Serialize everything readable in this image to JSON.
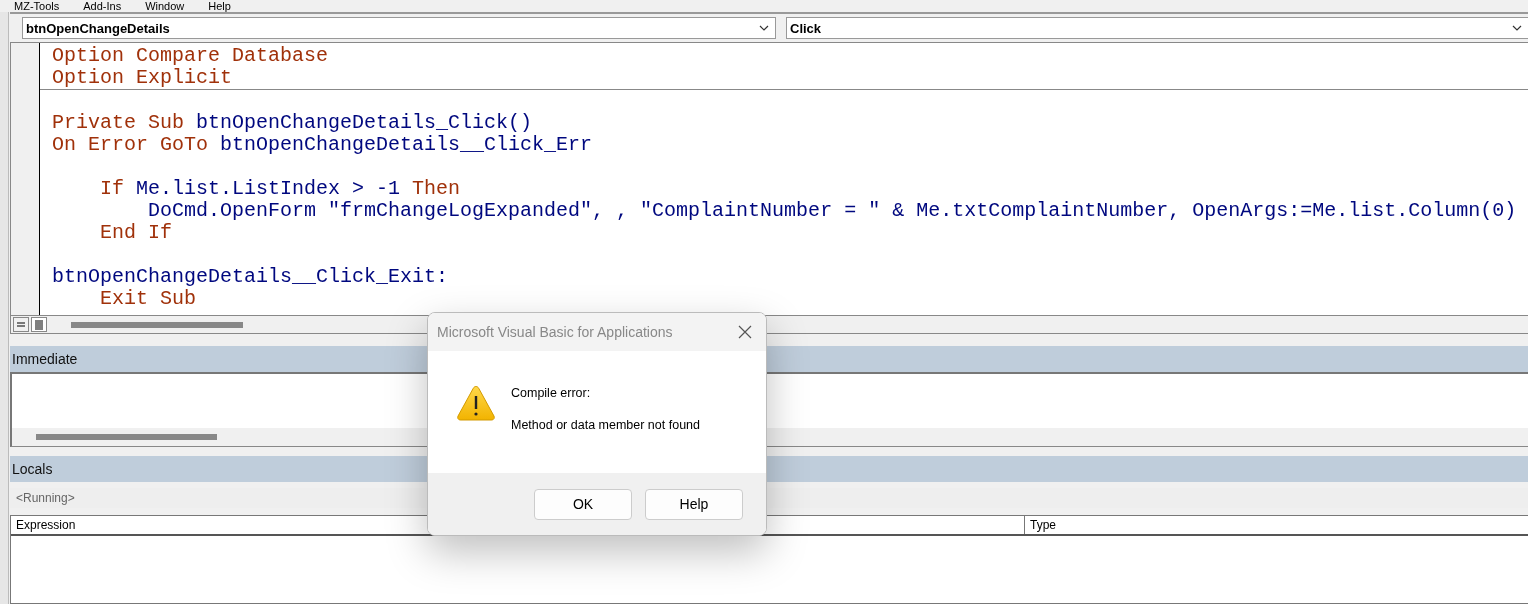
{
  "menu": [
    "MZ-Tools",
    "Add-Ins",
    "Window",
    "Help"
  ],
  "object_dropdown": "btnOpenChangeDetails",
  "procedure_dropdown": "Click",
  "code": {
    "sections": [
      {
        "lines": [
          {
            "kind": "code",
            "tokens": [
              {
                "text": "Option Compare Database",
                "kind": "keyword"
              }
            ]
          },
          {
            "kind": "code",
            "tokens": [
              {
                "text": "Option Explicit",
                "kind": "keyword"
              }
            ]
          }
        ]
      },
      {
        "lines": [
          {
            "kind": "blank"
          },
          {
            "kind": "code",
            "tokens": [
              {
                "text": "Private Sub ",
                "kind": "keyword"
              },
              {
                "text": "btnOpenChangeDetails_Click()",
                "kind": "plain"
              }
            ]
          },
          {
            "kind": "code",
            "tokens": [
              {
                "text": "On Error GoTo ",
                "kind": "keyword"
              },
              {
                "text": "btnOpenChangeDetails__Click_Err",
                "kind": "plain"
              }
            ]
          },
          {
            "kind": "blank"
          },
          {
            "kind": "code",
            "tokens": [
              {
                "text": "    If ",
                "kind": "keyword"
              },
              {
                "text": "Me.list.ListIndex > -1 ",
                "kind": "plain"
              },
              {
                "text": "Then",
                "kind": "keyword"
              }
            ]
          },
          {
            "kind": "code",
            "tokens": [
              {
                "text": "        DoCmd.OpenForm \"frmChangeLogExpanded\", , \"ComplaintNumber = \" & Me.txtComplaintNumber, OpenArgs:=Me.list.Column(0)",
                "kind": "plain"
              }
            ]
          },
          {
            "kind": "code",
            "tokens": [
              {
                "text": "    End If",
                "kind": "keyword"
              }
            ]
          },
          {
            "kind": "blank"
          },
          {
            "kind": "code",
            "tokens": [
              {
                "text": "btnOpenChangeDetails__Click_Exit:",
                "kind": "plain"
              }
            ]
          },
          {
            "kind": "code",
            "tokens": [
              {
                "text": "    Exit Sub",
                "kind": "keyword"
              }
            ]
          }
        ]
      }
    ]
  },
  "immediate": {
    "title": "Immediate"
  },
  "locals": {
    "title": "Locals",
    "context": "<Running>",
    "columns": [
      "Expression",
      "Type"
    ]
  },
  "dialog": {
    "title": "Microsoft Visual Basic for Applications",
    "heading": "Compile error:",
    "message": "Method or data member not found",
    "buttons": [
      "OK",
      "Help"
    ]
  }
}
